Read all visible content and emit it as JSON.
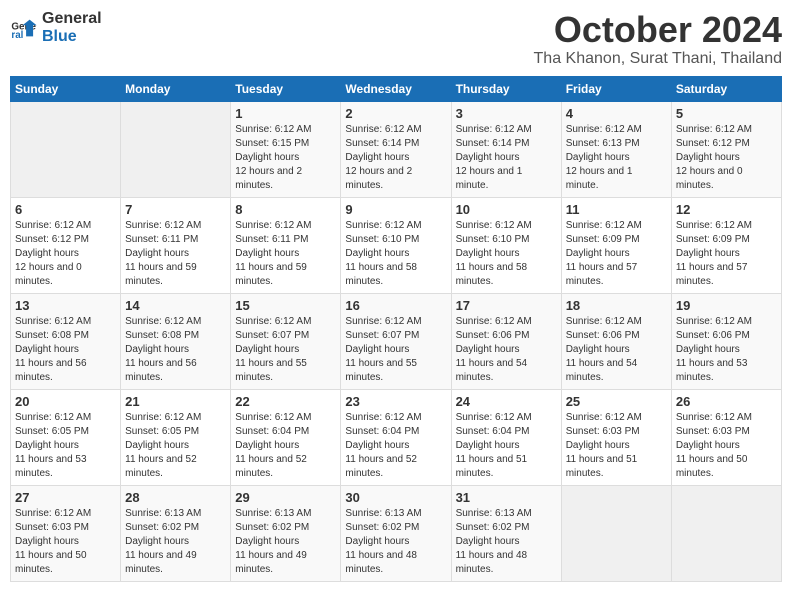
{
  "logo": {
    "general": "General",
    "blue": "Blue"
  },
  "title": {
    "month": "October 2024",
    "location": "Tha Khanon, Surat Thani, Thailand"
  },
  "headers": [
    "Sunday",
    "Monday",
    "Tuesday",
    "Wednesday",
    "Thursday",
    "Friday",
    "Saturday"
  ],
  "weeks": [
    [
      {
        "day": "",
        "empty": true
      },
      {
        "day": "",
        "empty": true
      },
      {
        "day": "1",
        "sunrise": "6:12 AM",
        "sunset": "6:15 PM",
        "daylight": "12 hours and 2 minutes."
      },
      {
        "day": "2",
        "sunrise": "6:12 AM",
        "sunset": "6:14 PM",
        "daylight": "12 hours and 2 minutes."
      },
      {
        "day": "3",
        "sunrise": "6:12 AM",
        "sunset": "6:14 PM",
        "daylight": "12 hours and 1 minute."
      },
      {
        "day": "4",
        "sunrise": "6:12 AM",
        "sunset": "6:13 PM",
        "daylight": "12 hours and 1 minute."
      },
      {
        "day": "5",
        "sunrise": "6:12 AM",
        "sunset": "6:12 PM",
        "daylight": "12 hours and 0 minutes."
      }
    ],
    [
      {
        "day": "6",
        "sunrise": "6:12 AM",
        "sunset": "6:12 PM",
        "daylight": "12 hours and 0 minutes."
      },
      {
        "day": "7",
        "sunrise": "6:12 AM",
        "sunset": "6:11 PM",
        "daylight": "11 hours and 59 minutes."
      },
      {
        "day": "8",
        "sunrise": "6:12 AM",
        "sunset": "6:11 PM",
        "daylight": "11 hours and 59 minutes."
      },
      {
        "day": "9",
        "sunrise": "6:12 AM",
        "sunset": "6:10 PM",
        "daylight": "11 hours and 58 minutes."
      },
      {
        "day": "10",
        "sunrise": "6:12 AM",
        "sunset": "6:10 PM",
        "daylight": "11 hours and 58 minutes."
      },
      {
        "day": "11",
        "sunrise": "6:12 AM",
        "sunset": "6:09 PM",
        "daylight": "11 hours and 57 minutes."
      },
      {
        "day": "12",
        "sunrise": "6:12 AM",
        "sunset": "6:09 PM",
        "daylight": "11 hours and 57 minutes."
      }
    ],
    [
      {
        "day": "13",
        "sunrise": "6:12 AM",
        "sunset": "6:08 PM",
        "daylight": "11 hours and 56 minutes."
      },
      {
        "day": "14",
        "sunrise": "6:12 AM",
        "sunset": "6:08 PM",
        "daylight": "11 hours and 56 minutes."
      },
      {
        "day": "15",
        "sunrise": "6:12 AM",
        "sunset": "6:07 PM",
        "daylight": "11 hours and 55 minutes."
      },
      {
        "day": "16",
        "sunrise": "6:12 AM",
        "sunset": "6:07 PM",
        "daylight": "11 hours and 55 minutes."
      },
      {
        "day": "17",
        "sunrise": "6:12 AM",
        "sunset": "6:06 PM",
        "daylight": "11 hours and 54 minutes."
      },
      {
        "day": "18",
        "sunrise": "6:12 AM",
        "sunset": "6:06 PM",
        "daylight": "11 hours and 54 minutes."
      },
      {
        "day": "19",
        "sunrise": "6:12 AM",
        "sunset": "6:06 PM",
        "daylight": "11 hours and 53 minutes."
      }
    ],
    [
      {
        "day": "20",
        "sunrise": "6:12 AM",
        "sunset": "6:05 PM",
        "daylight": "11 hours and 53 minutes."
      },
      {
        "day": "21",
        "sunrise": "6:12 AM",
        "sunset": "6:05 PM",
        "daylight": "11 hours and 52 minutes."
      },
      {
        "day": "22",
        "sunrise": "6:12 AM",
        "sunset": "6:04 PM",
        "daylight": "11 hours and 52 minutes."
      },
      {
        "day": "23",
        "sunrise": "6:12 AM",
        "sunset": "6:04 PM",
        "daylight": "11 hours and 52 minutes."
      },
      {
        "day": "24",
        "sunrise": "6:12 AM",
        "sunset": "6:04 PM",
        "daylight": "11 hours and 51 minutes."
      },
      {
        "day": "25",
        "sunrise": "6:12 AM",
        "sunset": "6:03 PM",
        "daylight": "11 hours and 51 minutes."
      },
      {
        "day": "26",
        "sunrise": "6:12 AM",
        "sunset": "6:03 PM",
        "daylight": "11 hours and 50 minutes."
      }
    ],
    [
      {
        "day": "27",
        "sunrise": "6:12 AM",
        "sunset": "6:03 PM",
        "daylight": "11 hours and 50 minutes."
      },
      {
        "day": "28",
        "sunrise": "6:13 AM",
        "sunset": "6:02 PM",
        "daylight": "11 hours and 49 minutes."
      },
      {
        "day": "29",
        "sunrise": "6:13 AM",
        "sunset": "6:02 PM",
        "daylight": "11 hours and 49 minutes."
      },
      {
        "day": "30",
        "sunrise": "6:13 AM",
        "sunset": "6:02 PM",
        "daylight": "11 hours and 48 minutes."
      },
      {
        "day": "31",
        "sunrise": "6:13 AM",
        "sunset": "6:02 PM",
        "daylight": "11 hours and 48 minutes."
      },
      {
        "day": "",
        "empty": true
      },
      {
        "day": "",
        "empty": true
      }
    ]
  ],
  "labels": {
    "sunrise": "Sunrise:",
    "sunset": "Sunset:",
    "daylight": "Daylight hours"
  }
}
